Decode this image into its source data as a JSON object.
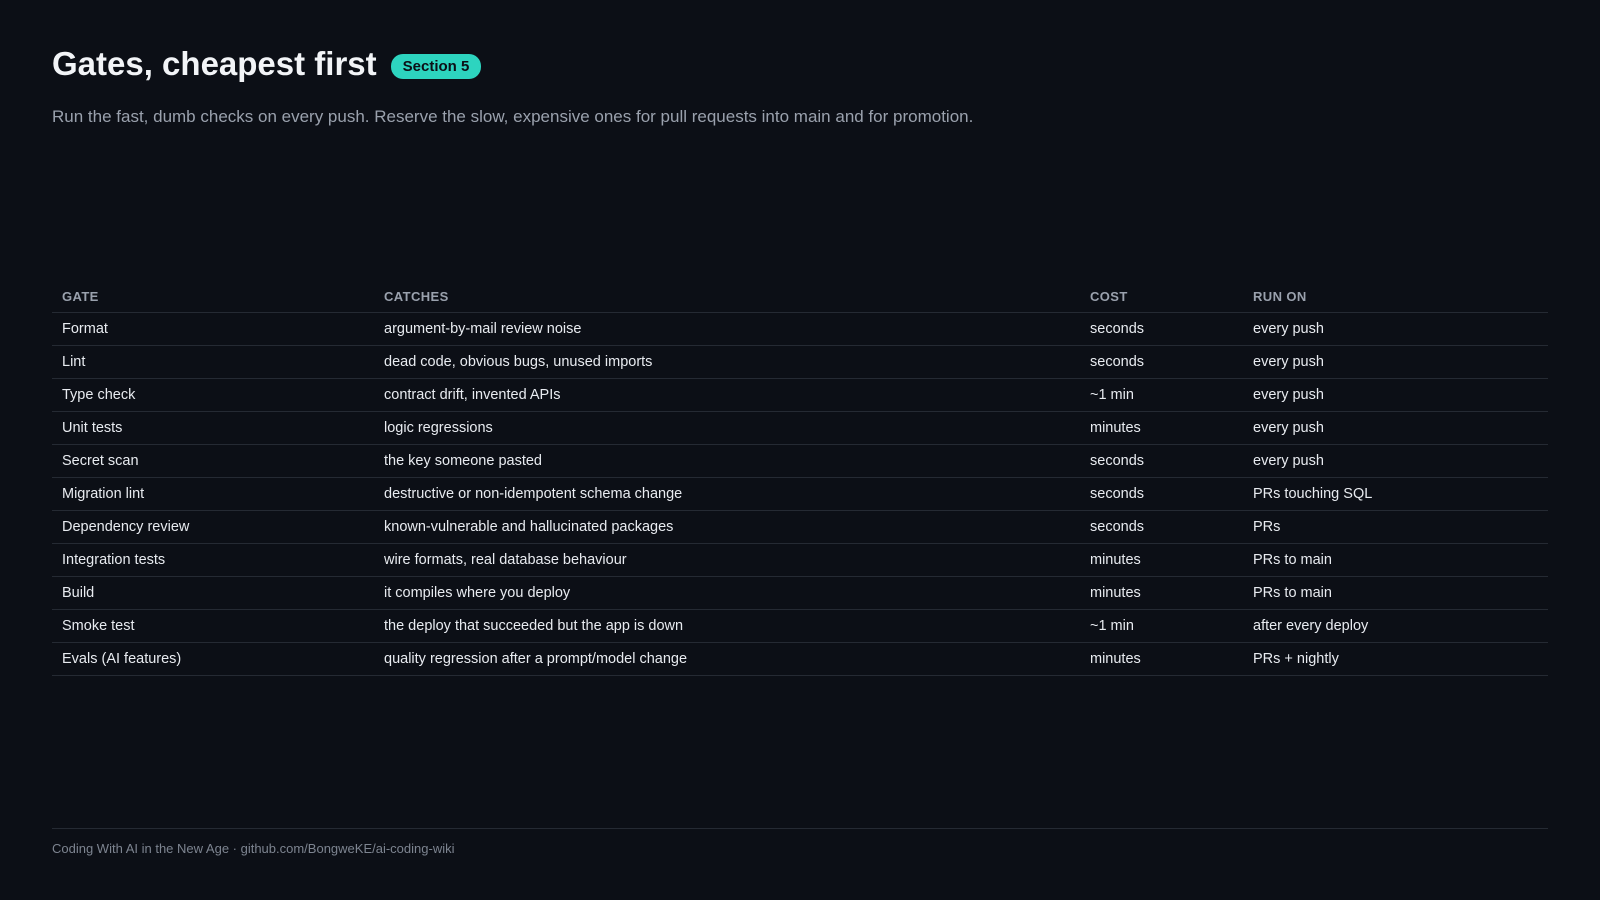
{
  "title": "Gates, cheapest first",
  "badge": "Section 5",
  "subtitle": "Run the fast, dumb checks on every push. Reserve the slow, expensive ones for pull requests into main and for promotion.",
  "table": {
    "headers": [
      "GATE",
      "CATCHES",
      "COST",
      "RUN ON"
    ],
    "rows": [
      [
        "Format",
        "argument-by-mail review noise",
        "seconds",
        "every push"
      ],
      [
        "Lint",
        "dead code, obvious bugs, unused imports",
        "seconds",
        "every push"
      ],
      [
        "Type check",
        "contract drift, invented APIs",
        "~1 min",
        "every push"
      ],
      [
        "Unit tests",
        "logic regressions",
        "minutes",
        "every push"
      ],
      [
        "Secret scan",
        "the key someone pasted",
        "seconds",
        "every push"
      ],
      [
        "Migration lint",
        "destructive or non-idempotent schema change",
        "seconds",
        "PRs touching SQL"
      ],
      [
        "Dependency review",
        "known-vulnerable and hallucinated packages",
        "seconds",
        "PRs"
      ],
      [
        "Integration tests",
        "wire formats, real database behaviour",
        "minutes",
        "PRs to main"
      ],
      [
        "Build",
        "it compiles where you deploy",
        "minutes",
        "PRs to main"
      ],
      [
        "Smoke test",
        "the deploy that succeeded but the app is down",
        "~1 min",
        "after every deploy"
      ],
      [
        "Evals (AI features)",
        "quality regression after a prompt/model change",
        "minutes",
        "PRs + nightly"
      ]
    ]
  },
  "footer": "Coding With AI in the New Age · github.com/BongweKE/ai-coding-wiki",
  "colors": {
    "background": "#0c0f16",
    "accent": "#2dd4bf",
    "text": "#e8ebf0",
    "muted": "#9aa1ad",
    "divider": "#252a33"
  }
}
